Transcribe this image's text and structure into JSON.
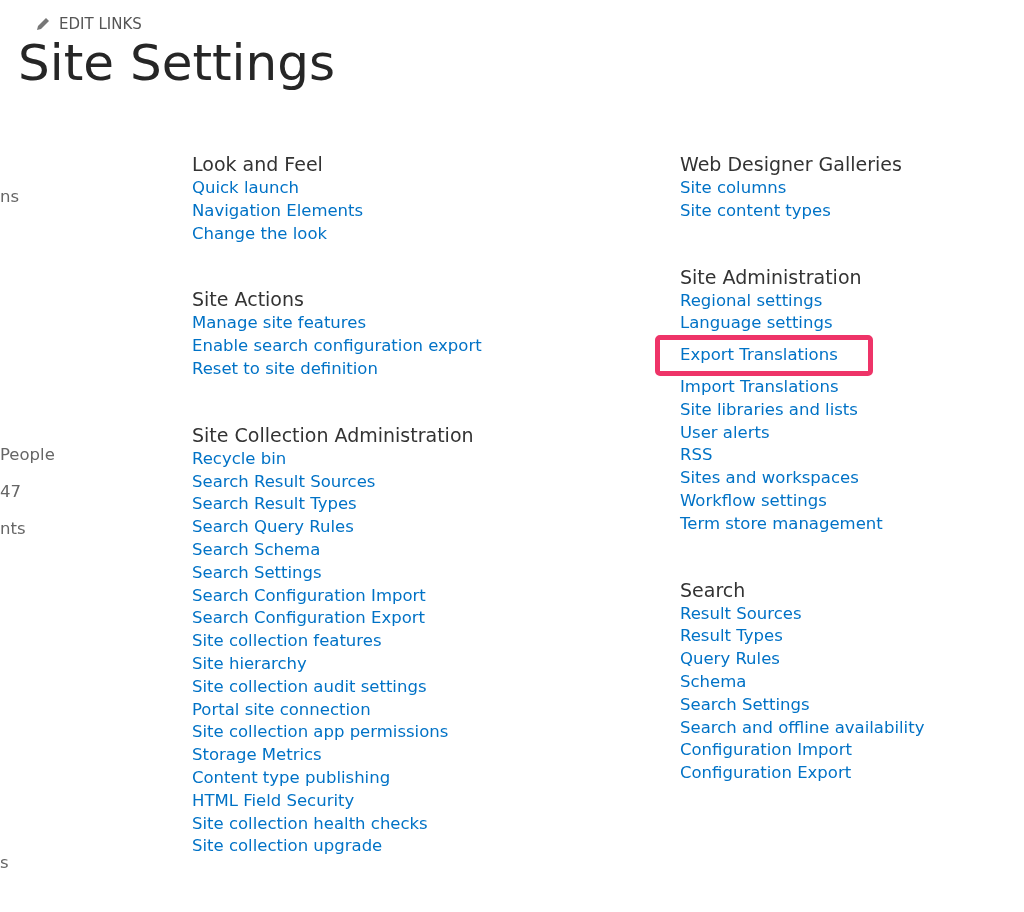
{
  "edit_links": "EDIT LINKS",
  "title": "Site Settings",
  "left_nav": [
    {
      "label": "ns"
    },
    {
      "label": "People"
    },
    {
      "label": "47"
    },
    {
      "label": "nts"
    },
    {
      "label": "s"
    }
  ],
  "columns": [
    [
      {
        "heading": "Look and Feel",
        "links": [
          {
            "label": "Quick launch",
            "highlighted": false
          },
          {
            "label": "Navigation Elements",
            "highlighted": false
          },
          {
            "label": "Change the look",
            "highlighted": false
          }
        ]
      },
      {
        "heading": "Site Actions",
        "links": [
          {
            "label": "Manage site features",
            "highlighted": false
          },
          {
            "label": "Enable search configuration export",
            "highlighted": false
          },
          {
            "label": "Reset to site definition",
            "highlighted": false
          }
        ]
      },
      {
        "heading": "Site Collection Administration",
        "links": [
          {
            "label": "Recycle bin",
            "highlighted": false
          },
          {
            "label": "Search Result Sources",
            "highlighted": false
          },
          {
            "label": "Search Result Types",
            "highlighted": false
          },
          {
            "label": "Search Query Rules",
            "highlighted": false
          },
          {
            "label": "Search Schema",
            "highlighted": false
          },
          {
            "label": "Search Settings",
            "highlighted": false
          },
          {
            "label": "Search Configuration Import",
            "highlighted": false
          },
          {
            "label": "Search Configuration Export",
            "highlighted": false
          },
          {
            "label": "Site collection features",
            "highlighted": false
          },
          {
            "label": "Site hierarchy",
            "highlighted": false
          },
          {
            "label": "Site collection audit settings",
            "highlighted": false
          },
          {
            "label": "Portal site connection",
            "highlighted": false
          },
          {
            "label": "Site collection app permissions",
            "highlighted": false
          },
          {
            "label": "Storage Metrics",
            "highlighted": false
          },
          {
            "label": "Content type publishing",
            "highlighted": false
          },
          {
            "label": "HTML Field Security",
            "highlighted": false
          },
          {
            "label": "Site collection health checks",
            "highlighted": false
          },
          {
            "label": "Site collection upgrade",
            "highlighted": false
          }
        ]
      }
    ],
    [
      {
        "heading": "Web Designer Galleries",
        "links": [
          {
            "label": "Site columns",
            "highlighted": false
          },
          {
            "label": "Site content types",
            "highlighted": false
          }
        ]
      },
      {
        "heading": "Site Administration",
        "links": [
          {
            "label": "Regional settings",
            "highlighted": false
          },
          {
            "label": "Language settings",
            "highlighted": false
          },
          {
            "label": "Export Translations",
            "highlighted": true
          },
          {
            "label": "Import Translations",
            "highlighted": false
          },
          {
            "label": "Site libraries and lists",
            "highlighted": false
          },
          {
            "label": "User alerts",
            "highlighted": false
          },
          {
            "label": "RSS",
            "highlighted": false
          },
          {
            "label": "Sites and workspaces",
            "highlighted": false
          },
          {
            "label": "Workflow settings",
            "highlighted": false
          },
          {
            "label": "Term store management",
            "highlighted": false
          }
        ]
      },
      {
        "heading": "Search",
        "links": [
          {
            "label": "Result Sources",
            "highlighted": false
          },
          {
            "label": "Result Types",
            "highlighted": false
          },
          {
            "label": "Query Rules",
            "highlighted": false
          },
          {
            "label": "Schema",
            "highlighted": false
          },
          {
            "label": "Search Settings",
            "highlighted": false
          },
          {
            "label": "Search and offline availability",
            "highlighted": false
          },
          {
            "label": "Configuration Import",
            "highlighted": false
          },
          {
            "label": "Configuration Export",
            "highlighted": false
          }
        ]
      }
    ]
  ]
}
